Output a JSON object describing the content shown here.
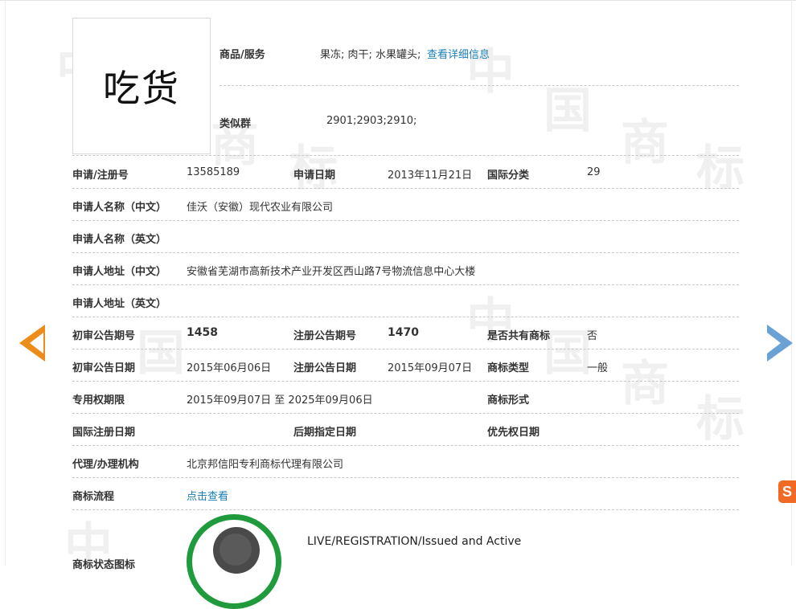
{
  "logo": {
    "text": "吃货"
  },
  "goods": {
    "label": "商品/服务",
    "value": "果冻; 肉干; 水果罐头;",
    "link": "查看详细信息"
  },
  "similar_group": {
    "label": "类似群",
    "value": "2901;2903;2910;"
  },
  "rows": {
    "reg_no": {
      "label": "申请/注册号",
      "value": "13585189"
    },
    "apply_date": {
      "label": "申请日期",
      "value": "2013年11月21日"
    },
    "intl_class": {
      "label": "国际分类",
      "value": "29"
    },
    "applicant_cn": {
      "label": "申请人名称（中文）",
      "value": "佳沃（安徽）现代农业有限公司"
    },
    "applicant_en": {
      "label": "申请人名称（英文）",
      "value": ""
    },
    "address_cn": {
      "label": "申请人地址（中文）",
      "value": "安徽省芜湖市高新技术产业开发区西山路7号物流信息中心大楼"
    },
    "address_en": {
      "label": "申请人地址（英文）",
      "value": ""
    },
    "prelim_issue_no": {
      "label": "初审公告期号",
      "value": "1458"
    },
    "reg_issue_no": {
      "label": "注册公告期号",
      "value": "1470"
    },
    "shared": {
      "label": "是否共有商标",
      "value": "否"
    },
    "prelim_date": {
      "label": "初审公告日期",
      "value": "2015年06月06日"
    },
    "reg_date": {
      "label": "注册公告日期",
      "value": "2015年09月07日"
    },
    "mark_type": {
      "label": "商标类型",
      "value": "一般"
    },
    "exclusive_period": {
      "label": "专用权期限",
      "value": "2015年09月07日 至 2025年09月06日"
    },
    "mark_form": {
      "label": "商标形式",
      "value": ""
    },
    "intl_reg_date": {
      "label": "国际注册日期",
      "value": ""
    },
    "later_designation": {
      "label": "后期指定日期",
      "value": ""
    },
    "priority_date": {
      "label": "优先权日期",
      "value": ""
    },
    "agent": {
      "label": "代理/办理机构",
      "value": "北京邦信阳专利商标代理有限公司"
    },
    "process": {
      "label": "商标流程",
      "link": "点击查看"
    },
    "status_icon": {
      "label": "商标状态图标",
      "text": "LIVE/REGISTRATION/Issued and Active"
    }
  },
  "watermark": {
    "chars": [
      "中",
      "国",
      "商",
      "标"
    ]
  },
  "side_badge": {
    "text": "S"
  },
  "colors": {
    "link": "#1a7fb4",
    "prev_arrow": "#ee8c1a",
    "next_arrow": "#6aa2d6",
    "seal": "#1f9a3c"
  }
}
